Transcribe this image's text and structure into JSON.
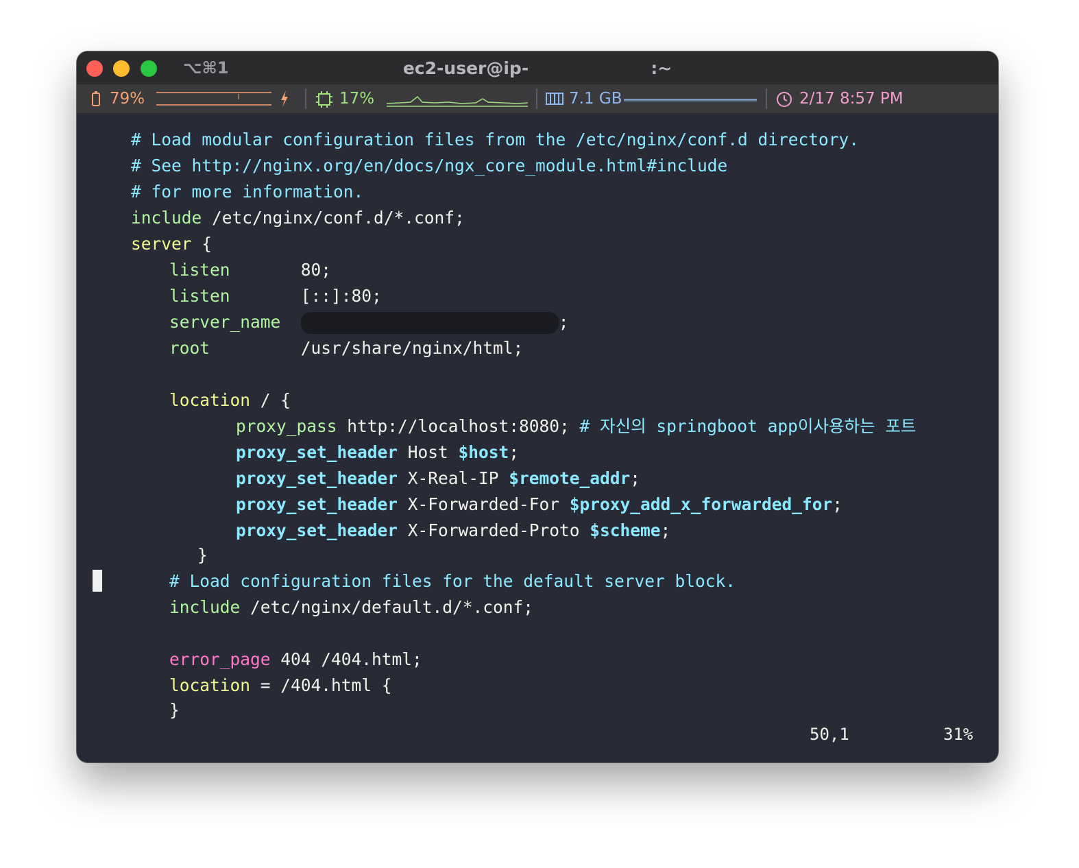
{
  "window": {
    "shortcut": "⌥⌘1",
    "title_prefix": "ec2-user@ip-",
    "title_suffix": ":~"
  },
  "statusbar": {
    "battery": "79%",
    "cpu": "17%",
    "memory": "7.1 GB",
    "datetime": "2/17 8:57 PM"
  },
  "colors": {
    "background": "#282a36",
    "comment": "#8be9fd",
    "keyword": "#f1fa8c",
    "directive": "#50fa7b",
    "error_page": "#ff79c6"
  },
  "code": {
    "l1": "# Load modular configuration files from the /etc/nginx/conf.d directory.",
    "l2": "# See http://nginx.org/en/docs/ngx_core_module.html#include",
    "l3": "# for more information.",
    "l4_kw": "include",
    "l4_arg": " /etc/nginx/conf.d/*.conf;",
    "l5_kw": "server",
    "l5_rest": " {",
    "l6_kw": "listen",
    "l6_arg": "       80;",
    "l7_kw": "listen",
    "l7_arg": "       [::]:80;",
    "l8_kw": "server_name",
    "l8_end": ";",
    "l9_kw": "root",
    "l9_arg": "         /usr/share/nginx/html;",
    "l10_kw": "location",
    "l10_rest": " / {",
    "l11_kw": "proxy_pass",
    "l11_arg": " http://localhost:8080;",
    "l11_cm": " # 자신의 springboot app이사용하는 포트",
    "l12_kw": "proxy_set_header",
    "l12_arg": " Host ",
    "l12_var": "$host",
    "l12_end": ";",
    "l13_kw": "proxy_set_header",
    "l13_arg": " X-Real-IP ",
    "l13_var": "$remote_addr",
    "l13_end": ";",
    "l14_kw": "proxy_set_header",
    "l14_arg": " X-Forwarded-For ",
    "l14_var": "$proxy_add_x_forwarded_for",
    "l14_end": ";",
    "l15_kw": "proxy_set_header",
    "l15_arg": " X-Forwarded-Proto ",
    "l15_var": "$scheme",
    "l15_end": ";",
    "l16": "}",
    "l17": "# Load configuration files for the default server block.",
    "l18_kw": "include",
    "l18_arg": " /etc/nginx/default.d/*.conf;",
    "l19_kw": "error_page",
    "l19_arg": " 404 /404.html;",
    "l20_kw": "location",
    "l20_arg": " = /404.html {",
    "l21": "}"
  },
  "ruler": {
    "position": "50,1",
    "percent": "31%"
  }
}
